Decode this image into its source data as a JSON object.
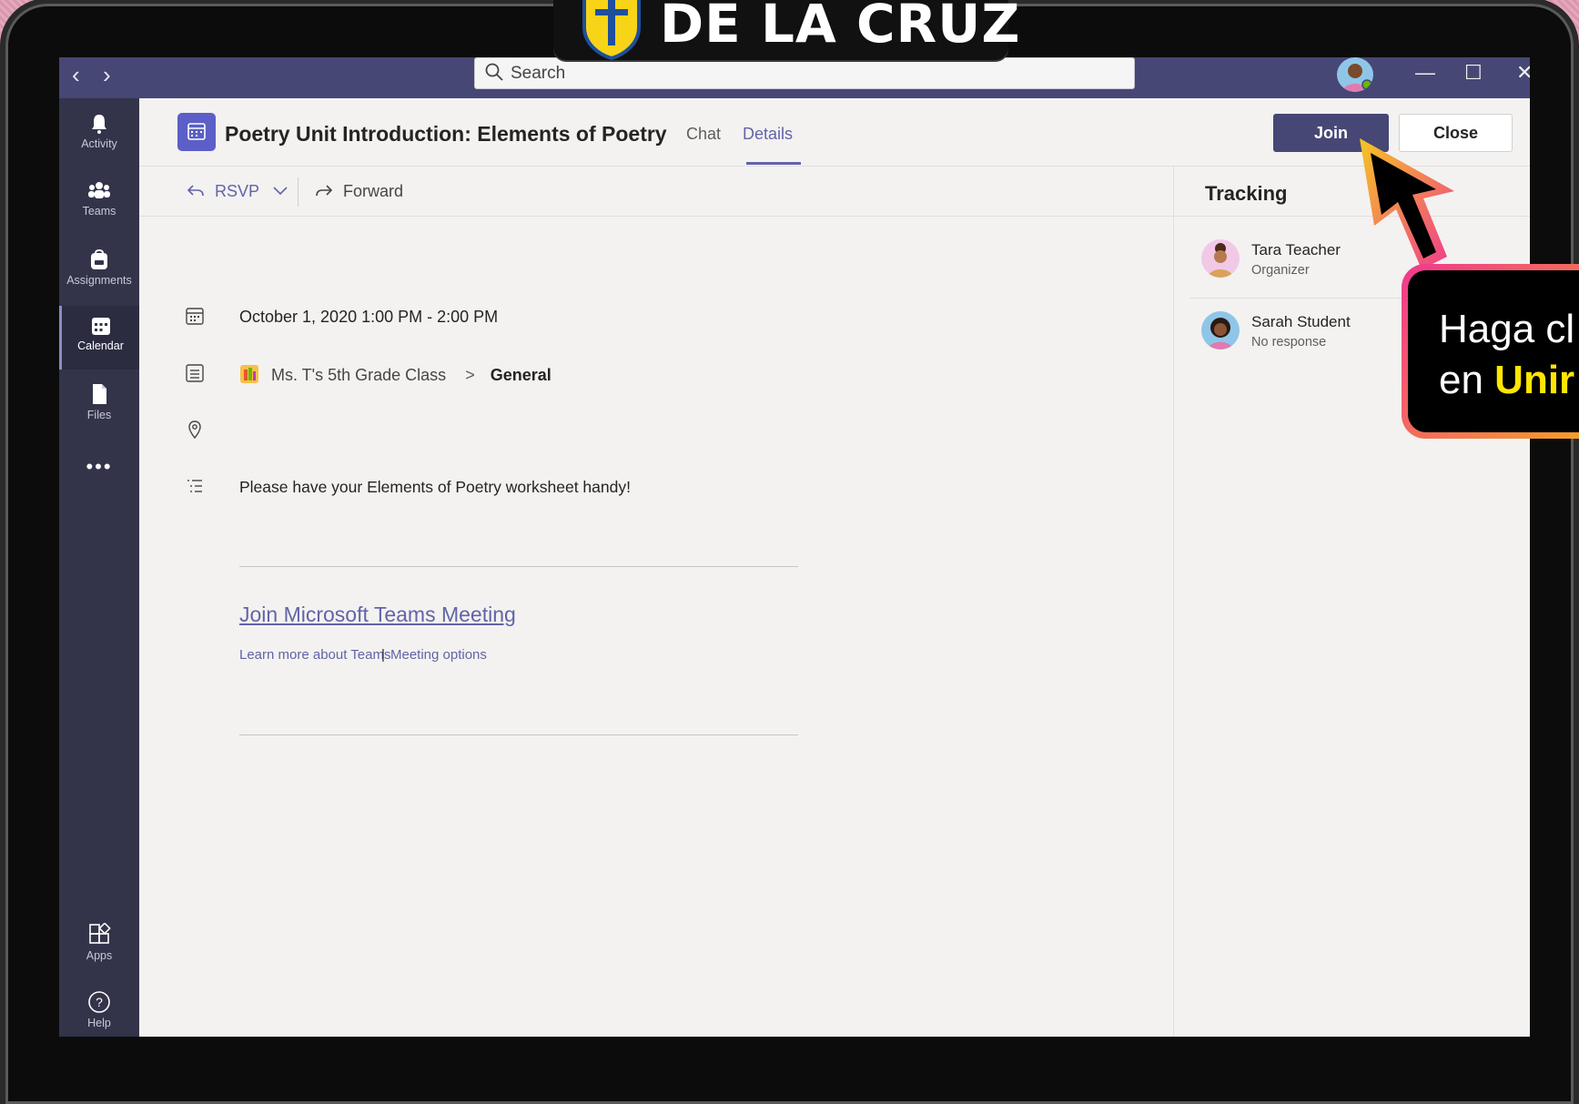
{
  "brand": {
    "name": "DE LA CRUZ"
  },
  "titlebar": {
    "back_icon": "chevron-left-icon",
    "forward_icon": "chevron-right-icon",
    "search_placeholder": "Search",
    "minimize": "—",
    "maximize": "☐",
    "close": "✕"
  },
  "appbar": {
    "items": [
      {
        "label": "Activity",
        "icon": "bell-icon"
      },
      {
        "label": "Teams",
        "icon": "teams-icon"
      },
      {
        "label": "Assignments",
        "icon": "backpack-icon"
      },
      {
        "label": "Calendar",
        "icon": "calendar-icon",
        "active": true
      },
      {
        "label": "Files",
        "icon": "file-icon"
      },
      {
        "label": "•••",
        "icon": "more-icon"
      }
    ],
    "bottom": [
      {
        "label": "Apps",
        "icon": "apps-icon"
      },
      {
        "label": "Help",
        "icon": "help-icon"
      }
    ]
  },
  "header": {
    "title": "Poetry Unit Introduction: Elements of Poetry",
    "tabs": [
      "Chat",
      "Details"
    ],
    "active_tab": "Details",
    "join_label": "Join",
    "close_label": "Close"
  },
  "toolbar": {
    "rsvp_label": "RSVP",
    "forward_label": "Forward"
  },
  "details": {
    "datetime": "October 1, 2020 1:00 PM - 2:00 PM",
    "team": "Ms. T's 5th Grade Class",
    "separator": ">",
    "channel": "General",
    "description": "Please have your Elements of Poetry worksheet handy!",
    "join_link": "Join Microsoft Teams Meeting",
    "learn_more": "Learn more about Teams",
    "link_separator": "|",
    "meeting_options": "Meeting options"
  },
  "tracking": {
    "title": "Tracking",
    "people": [
      {
        "name": "Tara Teacher",
        "status": "Organizer"
      },
      {
        "name": "Sarah Student",
        "status": "No response"
      }
    ]
  },
  "callout": {
    "line1": "Haga cl",
    "line2_prefix": "en ",
    "line2_bold": "Unir"
  },
  "colors": {
    "teams_purple": "#464775",
    "accent": "#6264a7",
    "appbar": "#33344a",
    "background": "#f3f2f1"
  }
}
